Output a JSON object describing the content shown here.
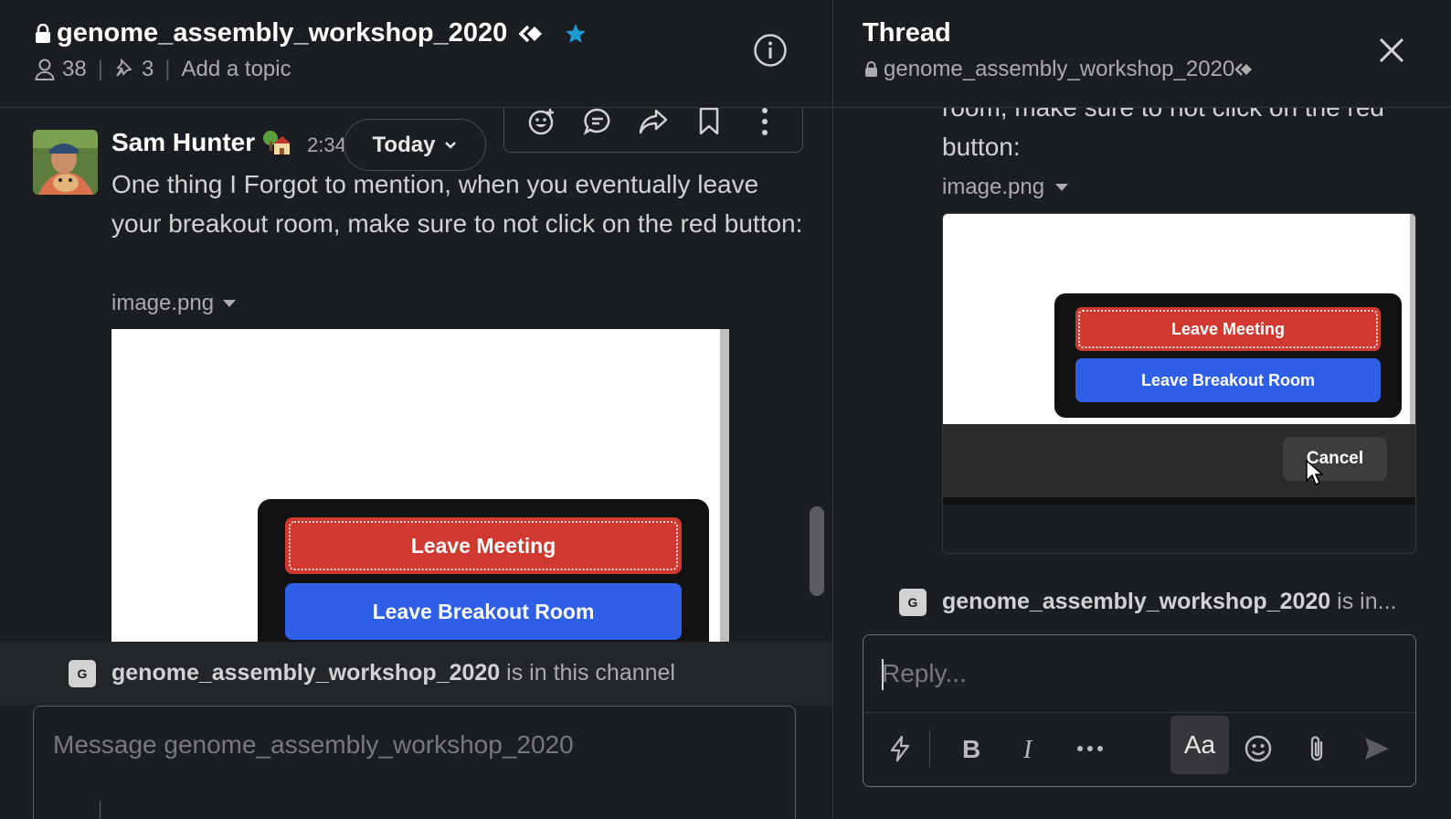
{
  "channel": {
    "name": "genome_assembly_workshop_2020",
    "member_count": "38",
    "pinned_count": "3",
    "topic_placeholder": "Add a topic"
  },
  "message": {
    "author": "Sam Hunter",
    "time": "2:34",
    "date_pill": "Today",
    "text": "One thing I Forgot to mention, when you eventually leave your breakout room, make sure to not click on the red button:",
    "file_name": "image.png"
  },
  "image": {
    "leave_meeting": "Leave Meeting",
    "leave_breakout": "Leave Breakout Room",
    "cancel": "Cancel"
  },
  "channel_note": {
    "name": "genome_assembly_workshop_2020",
    "suffix": " is in this channel",
    "badge": "G"
  },
  "composer": {
    "placeholder": "Message genome_assembly_workshop_2020"
  },
  "thread": {
    "title": "Thread",
    "channel": "genome_assembly_workshop_2020",
    "text": "room, make sure to not click on the red button:",
    "file_name": "image.png",
    "note_name": "genome_assembly_workshop_2020",
    "note_suffix": " is in...",
    "badge": "G",
    "reply_placeholder": "Reply...",
    "aa_label": "Aa"
  },
  "colors": {
    "background": "#1a1d21",
    "star": "#1d9bd1",
    "leave_red": "#d0392f",
    "breakout_blue": "#2e5fe6"
  }
}
